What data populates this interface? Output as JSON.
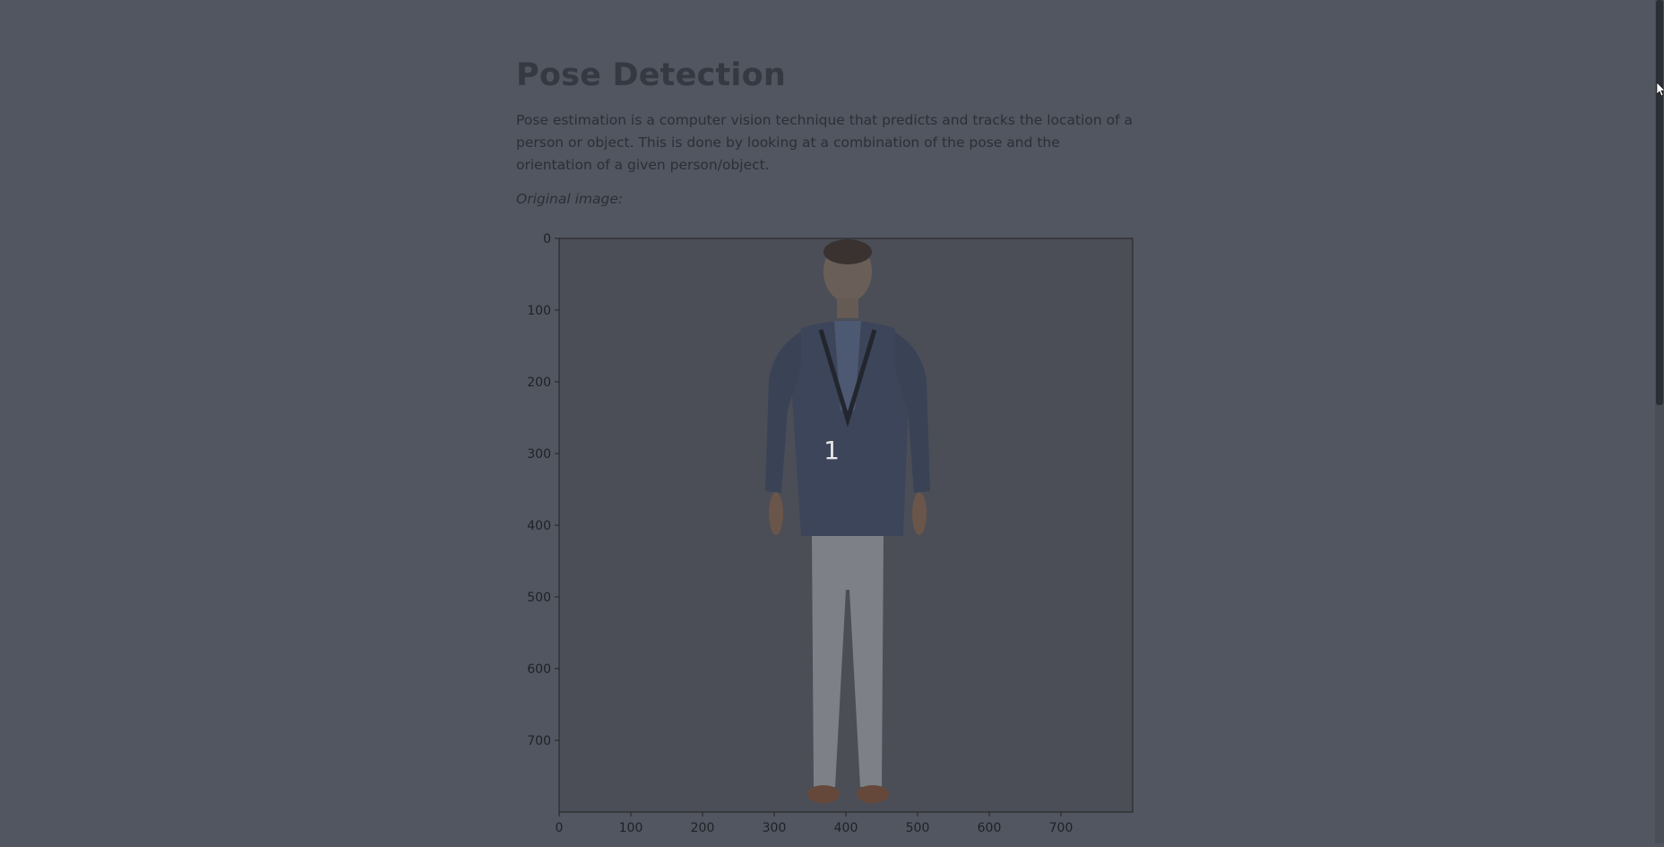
{
  "page": {
    "title": "Pose Detection",
    "description": "Pose estimation is a computer vision technique that predicts and tracks the location of a person or object. This is done by looking at a combination of the pose and the orientation of a given person/object.",
    "caption": "Original image:"
  },
  "chart_data": {
    "type": "image",
    "x_ticks": [
      "0",
      "100",
      "200",
      "300",
      "400",
      "500",
      "600",
      "700"
    ],
    "y_ticks": [
      "0",
      "100",
      "200",
      "300",
      "400",
      "500",
      "600",
      "700"
    ],
    "xlim": [
      0,
      800
    ],
    "ylim": [
      800,
      0
    ],
    "annotations": [
      {
        "label": "1",
        "x": 380,
        "y": 295
      }
    ]
  },
  "colors": {
    "overlay": "#525660",
    "image_bg": "#4a4d55",
    "jacket": "#3a4256",
    "pants": "#8a8c92",
    "shoes": "#6b4a33"
  },
  "icons": {
    "cursor": "arrow-cursor-icon"
  }
}
